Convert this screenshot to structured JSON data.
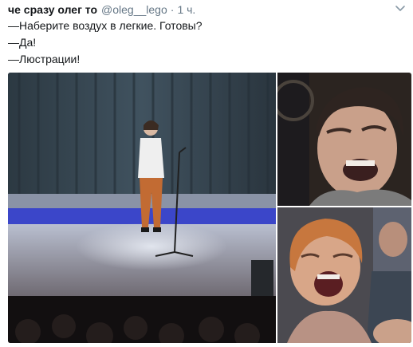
{
  "tweet": {
    "display_name": "че сразу олег то",
    "handle": "@oleg__lego",
    "separator": "·",
    "time": "1 ч.",
    "icons": {
      "more": "chevron-down-icon"
    },
    "lines": [
      "—Наберите воздух в легкие. Готовы?",
      "—Да!",
      "—Люстрации!"
    ]
  },
  "media": {
    "count": 3,
    "items": [
      {
        "kind": "photo",
        "subject": "stage-performer-with-microphone"
      },
      {
        "kind": "photo",
        "subject": "laughing-young-man"
      },
      {
        "kind": "photo",
        "subject": "laughing-woman"
      }
    ]
  },
  "colors": {
    "text": "#14171a",
    "secondary": "#657786",
    "background": "#ffffff",
    "curtain": "#3a4a56",
    "stage_blue": "#3b46c9"
  }
}
